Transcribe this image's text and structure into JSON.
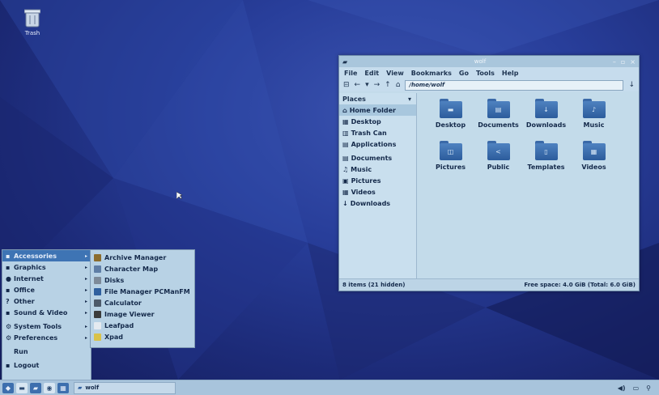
{
  "desktop": {
    "trash_label": "Trash"
  },
  "file_manager": {
    "window_title": "wolf",
    "window_controls": [
      "–",
      "▫",
      "×"
    ],
    "menus": [
      "File",
      "Edit",
      "View",
      "Bookmarks",
      "Go",
      "Tools",
      "Help"
    ],
    "toolbar": {
      "path": "/home/wolf"
    },
    "sidebar": {
      "header": "Places",
      "items": [
        "Home Folder",
        "Desktop",
        "Trash Can",
        "Applications",
        "Documents",
        "Music",
        "Pictures",
        "Videos",
        "Downloads"
      ]
    },
    "files": [
      "Desktop",
      "Documents",
      "Downloads",
      "Music",
      "Pictures",
      "Public",
      "Templates",
      "Videos"
    ],
    "status_left": "8 items (21 hidden)",
    "status_right": "Free space: 4.0 GiB (Total: 6.0 GiB)"
  },
  "start_menu": {
    "items": [
      "Accessories",
      "Graphics",
      "Internet",
      "Office",
      "Other",
      "Sound & Video",
      "System Tools",
      "Preferences",
      "Run",
      "Logout"
    ],
    "submenu": [
      "Archive Manager",
      "Character Map",
      "Disks",
      "File Manager PCManFM",
      "Calculator",
      "Image Viewer",
      "Leafpad",
      "Xpad"
    ]
  },
  "taskbar": {
    "task_label": "wolf"
  },
  "colors": {
    "accent": "#3e74b4",
    "desktop": "#283e9a",
    "panel": "#a8c4dc"
  }
}
